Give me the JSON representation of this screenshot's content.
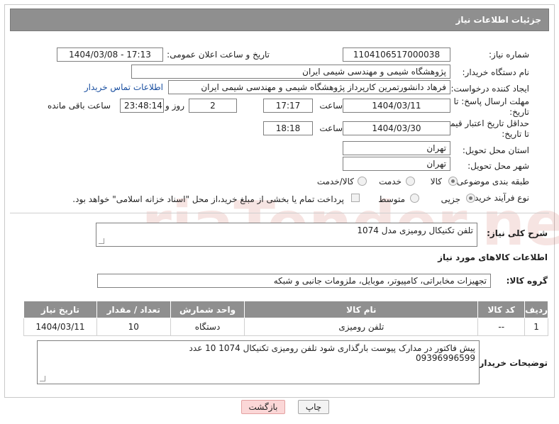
{
  "header": {
    "title": "جزئیات اطلاعات نیاز"
  },
  "fields": {
    "need_number_label": "شماره نیاز:",
    "need_number": "1104106517000038",
    "announce_label": "تاریخ و ساعت اعلان عمومی:",
    "announce_value": "1404/03/08 - 17:13",
    "buyer_org_label": "نام دستگاه خریدار:",
    "buyer_org": "پژوهشگاه شیمی و مهندسی شیمی ایران",
    "requester_label": "ایجاد کننده درخواست:",
    "requester": "فرهاد دانشورتمرین کارپرداز پژوهشگاه شیمی و مهندسی شیمی ایران",
    "contact_link": "اطلاعات تماس خریدار",
    "deadline_label_line1": "مهلت ارسال پاسخ: تا",
    "deadline_label_line2": "تاریخ:",
    "deadline_date": "1404/03/11",
    "time_label": "ساعت",
    "deadline_time": "17:17",
    "days_value": "2",
    "days_label": "روز و",
    "remaining_time": "23:48:14",
    "remaining_label": "ساعت باقی مانده",
    "validity_label_line1": "حداقل تاریخ اعتبار قیمت:",
    "validity_label_line2": "تا تاریخ:",
    "validity_date": "1404/03/30",
    "validity_time": "18:18",
    "province_label": "استان محل تحویل:",
    "province": "تهران",
    "city_label": "شهر محل تحویل:",
    "city": "تهران",
    "category_label": "طبقه بندی موضوعی:",
    "category_options": [
      "کالا",
      "خدمت",
      "کالا/خدمت"
    ],
    "process_label": "نوع فرآیند خرید :",
    "process_options": [
      "جزیی",
      "متوسط"
    ],
    "payment_note": "پرداخت تمام یا بخشی از مبلغ خرید،از محل \"اسناد خزانه اسلامی\" خواهد بود."
  },
  "description": {
    "label": "شرح کلی نیاز:",
    "value": "تلفن تکنیکال رومیزی مدل 1074"
  },
  "goods_section": {
    "title": "اطلاعات کالاهای مورد نیاز",
    "group_label": "گروه کالا:",
    "group_value": "تجهیزات مخابراتی، کامپیوتر، موبایل، ملزومات جانبی و شبکه"
  },
  "table": {
    "headers": [
      "ردیف",
      "کد کالا",
      "نام کالا",
      "واحد شمارش",
      "تعداد / مقدار",
      "تاریخ نیاز"
    ],
    "rows": [
      [
        "1",
        "--",
        "تلفن رومیزی",
        "دستگاه",
        "10",
        "1404/03/11"
      ]
    ]
  },
  "buyer_notes": {
    "label": "توضیحات خریدار:",
    "line1": "پیش فاکتور در مدارک پیوست بارگذاری شود تلفن رومیزی تکنیکال 1074   10 عدد",
    "line2": "09396996599"
  },
  "buttons": {
    "print": "چاپ",
    "back": "بازگشت"
  },
  "watermark": {
    "text": "AriaTender.neT"
  },
  "colors": {
    "header_bg": "#8f8f8f",
    "link": "#1a4fa0",
    "back_button": "#fbd7d7",
    "watermark": "#c0392b"
  }
}
